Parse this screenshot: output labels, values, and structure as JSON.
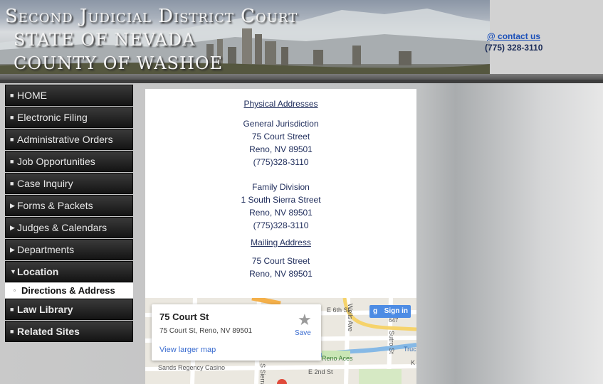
{
  "header": {
    "title_line1": "Second Judicial District Court",
    "title_line2": "STATE OF NEVADA",
    "title_line3": "COUNTY OF WASHOE",
    "contact_link": "@ contact us",
    "contact_phone": "(775) 328-3110"
  },
  "sidebar": {
    "items": [
      {
        "label": "HOME",
        "icon": "square-bullet-icon"
      },
      {
        "label": "Electronic Filing",
        "icon": "square-bullet-icon"
      },
      {
        "label": "Administrative Orders",
        "icon": "square-bullet-icon"
      },
      {
        "label": "Job Opportunities",
        "icon": "square-bullet-icon"
      },
      {
        "label": "Case Inquiry",
        "icon": "square-bullet-icon"
      },
      {
        "label": "Forms & Packets",
        "icon": "triangle-right-icon"
      },
      {
        "label": "Judges & Calendars",
        "icon": "triangle-right-icon"
      },
      {
        "label": "Departments",
        "icon": "triangle-right-icon"
      },
      {
        "label": "Location",
        "icon": "triangle-down-icon"
      },
      {
        "label": "Directions & Address",
        "icon": "square-bullet-icon"
      },
      {
        "label": "Law Library",
        "icon": "square-bullet-icon"
      },
      {
        "label": "Related Sites",
        "icon": "square-bullet-icon"
      }
    ]
  },
  "content": {
    "physical_heading": "Physical Addresses",
    "general": {
      "name": "General Jurisdiction",
      "street": "75 Court Street",
      "city": "Reno, NV 89501",
      "phone": "(775)328-3110"
    },
    "family": {
      "name": "Family Division",
      "street": "1 South Sierra Street",
      "city": "Reno, NV 89501",
      "phone": "(775)328-3110"
    },
    "mailing_heading": "Mailing Address",
    "mailing": {
      "street": "75 Court Street",
      "city": "Reno, NV 89501"
    }
  },
  "map": {
    "place_title": "75 Court St",
    "place_address": "75 Court St, Reno, NV 89501",
    "larger_map_link": "View larger map",
    "save_label": "Save",
    "signin_label": "Sign in",
    "labels": {
      "e6th": "E 6th St",
      "wells": "Wells Ave",
      "hwy": "647",
      "sutro": "Sutro St",
      "truckee": "Truc",
      "renoaces": "Reno Aces",
      "sands": "Sands Regency Casino",
      "sierra": "S Sierra",
      "e2nd": "E 2nd St",
      "k": "K"
    }
  },
  "colors": {
    "nav_background": "#1c1c1c",
    "link_blue": "#1b4fb8",
    "text_navy": "#1d2b5a"
  }
}
